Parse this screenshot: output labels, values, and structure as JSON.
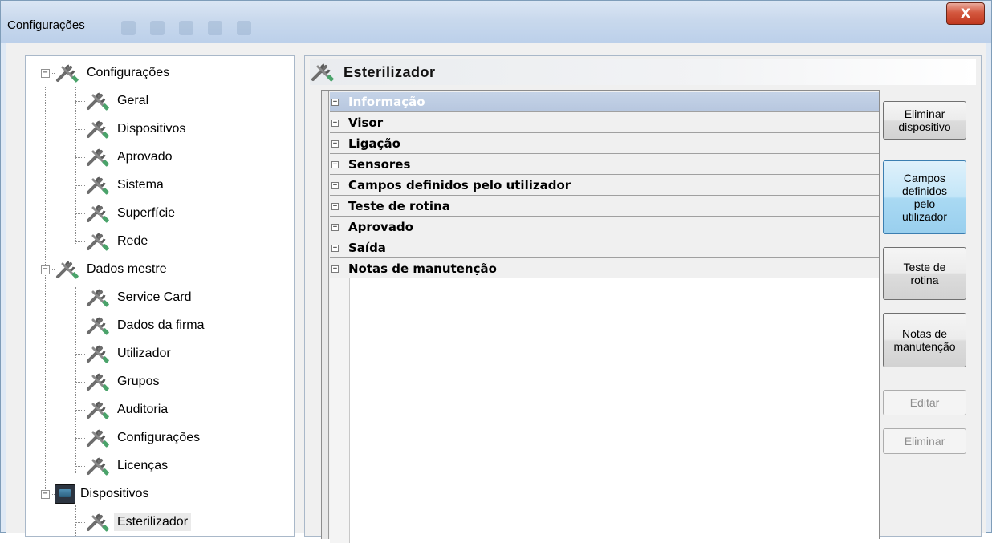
{
  "window": {
    "title": "Configurações",
    "close_label": "X"
  },
  "tree": {
    "root": "Configurações",
    "settings_items": [
      "Geral",
      "Dispositivos",
      "Aprovado",
      "Sistema",
      "Superfície",
      "Rede"
    ],
    "master_data": "Dados mestre",
    "master_items": [
      "Service Card",
      "Dados da firma",
      "Utilizador",
      "Grupos",
      "Auditoria",
      "Configurações",
      "Licenças"
    ],
    "devices": "Dispositivos",
    "device_items": [
      "Esterilizador"
    ],
    "selected": "Esterilizador"
  },
  "panel": {
    "title": "Esterilizador",
    "sections": [
      "Informação",
      "Visor",
      "Ligação",
      "Sensores",
      "Campos definidos pelo utilizador",
      "Teste de rotina",
      "Aprovado",
      "Saída",
      "Notas de manutenção"
    ],
    "selected_section": "Informação"
  },
  "buttons": {
    "delete_device": "Eliminar\ndispositivo",
    "user_fields": "Campos\ndefinidos\npelo\nutilizador",
    "routine_test": "Teste de\nrotina",
    "maintenance_notes": "Notas de\nmanutenção",
    "edit": "Editar",
    "delete": "Eliminar"
  }
}
